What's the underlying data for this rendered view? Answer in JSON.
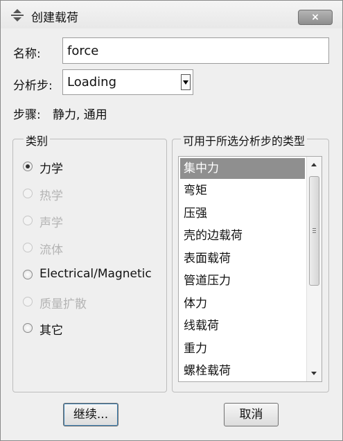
{
  "window": {
    "title": "创建载荷",
    "close_label": "×"
  },
  "form": {
    "name_label": "名称:",
    "name_value": "force",
    "step_label": "分析步:",
    "step_value": "Loading",
    "procedure_label": "步骤:",
    "procedure_value": "静力, 通用"
  },
  "category": {
    "title": "类别",
    "options": [
      {
        "label": "力学",
        "checked": true,
        "enabled": true
      },
      {
        "label": "热学",
        "checked": false,
        "enabled": false
      },
      {
        "label": "声学",
        "checked": false,
        "enabled": false
      },
      {
        "label": "流体",
        "checked": false,
        "enabled": false
      },
      {
        "label": "Electrical/Magnetic",
        "checked": false,
        "enabled": true
      },
      {
        "label": "质量扩散",
        "checked": false,
        "enabled": false
      },
      {
        "label": "其它",
        "checked": false,
        "enabled": true
      }
    ]
  },
  "types": {
    "title": "可用于所选分析步的类型",
    "items": [
      "集中力",
      "弯矩",
      "压强",
      "壳的边载荷",
      "表面载荷",
      "管道压力",
      "体力",
      "线载荷",
      "重力",
      "螺栓载荷"
    ],
    "selected_index": 0
  },
  "buttons": {
    "continue_label": "继续...",
    "cancel_label": "取消"
  }
}
